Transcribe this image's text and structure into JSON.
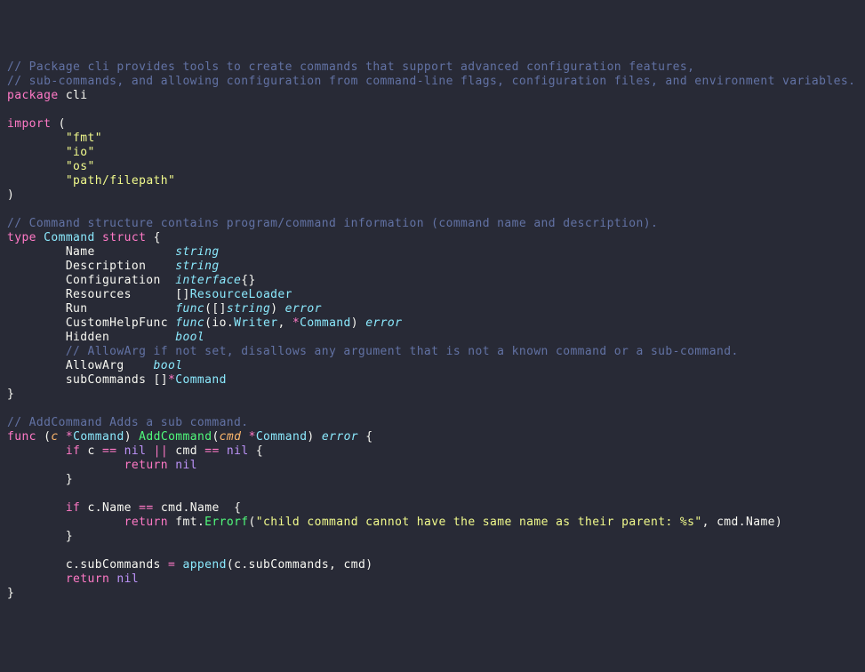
{
  "comment1": "// Package cli provides tools to create commands that support advanced configuration features,",
  "comment2": "// sub-commands, and allowing configuration from command-line flags, configuration files, and environment variables.",
  "pkg_kw": "package",
  "pkg_name": " cli",
  "import_kw": "import",
  "import_open": " (",
  "imp_fmt": "\"fmt\"",
  "imp_io": "\"io\"",
  "imp_os": "\"os\"",
  "imp_pf": "\"path/filepath\"",
  "paren_close": ")",
  "struct_comment": "// Command structure contains program/command information (command name and description).",
  "type_kw": "type",
  "cmd_type": " Command",
  "struct_kw": " struct",
  "brace_open": " {",
  "f_name": "        Name           ",
  "t_string": "string",
  "f_desc": "        Description    ",
  "f_conf": "        Configuration  ",
  "t_iface": "interface",
  "t_iface_b": "{}",
  "f_res": "        Resources      ",
  "t_res_slice": "[]",
  "t_res": "ResourceLoader",
  "f_run": "        Run            ",
  "t_func": "func",
  "run_lp": "(",
  "run_slice": "[]",
  "t_string2": "string",
  "run_rp": ")",
  "t_error": " error",
  "f_chelp": "        CustomHelpFunc ",
  "chelp_lp": "(",
  "chelp_io": "io",
  "chelp_dot": ".",
  "chelp_writer": "Writer",
  "chelp_sep": ", ",
  "chelp_star": "*",
  "chelp_cmd": "Command",
  "chelp_rp": ")",
  "f_hidden": "        Hidden         ",
  "t_bool": "bool",
  "allow_comment": "        // AllowArg if not set, disallows any argument that is not a known command or a sub-command.",
  "f_allow": "        AllowArg    ",
  "f_sub": "        subCommands ",
  "sub_slice": "[]",
  "sub_star": "*",
  "sub_cmd": "Command",
  "brace_close": "}",
  "add_comment": "// AddCommand Adds a sub command.",
  "func_kw": "func",
  "recv_open": " (",
  "recv_c": "c",
  "recv_star": " *",
  "recv_cmd": "Command",
  "recv_close": ") ",
  "addcmd_name": "AddCommand",
  "p_open": "(",
  "p_cmd": "cmd",
  "p_star": " *",
  "p_cmdtype": "Command",
  "p_close": ") ",
  "ret_error": "error",
  "fn_brace": " {",
  "if_kw": "if",
  "if1_c": " c ",
  "eq_op": "==",
  "nil_kw": " nil",
  "or_op": " || ",
  "if1_cmd": "cmd ",
  "if1_brace": " {",
  "return_kw": "return",
  "ret_nil": " nil",
  "inner_close": "        }",
  "if2_pre": " c",
  "dot": ".",
  "prop_name": "Name ",
  "if2_cmd": " cmd",
  "if2_brace": " {",
  "ret2": " fmt",
  "errorf": "Errorf",
  "err_lp": "(",
  "err_str": "\"child command cannot have the same name as their parent: %s\"",
  "err_sep": ", cmd",
  "err_nameprop": "Name",
  "err_rp": ")",
  "assign_pre": "        c",
  "prop_sub": "subCommands ",
  "assign_op": "=",
  "append_fn": " append",
  "app_lp": "(",
  "app_c": "c",
  "app_sub": "subCommands",
  "app_sep": ", cmd",
  "app_rp": ")",
  "final_ret": "        ",
  "sp": " ",
  "indent2": "        ",
  "indent4": "                "
}
